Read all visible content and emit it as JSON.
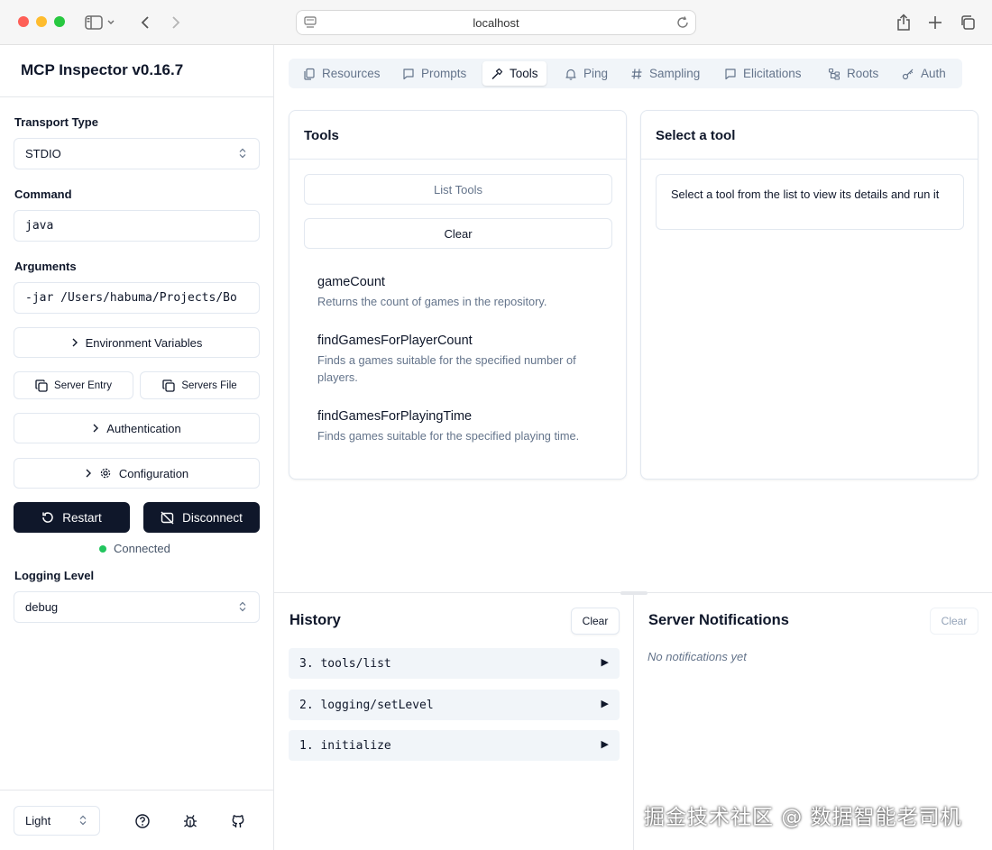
{
  "browser": {
    "url": "localhost"
  },
  "sidebar": {
    "title": "MCP Inspector v0.16.7",
    "transport_label": "Transport Type",
    "transport_value": "STDIO",
    "command_label": "Command",
    "command_value": "java",
    "arguments_label": "Arguments",
    "arguments_value": "-jar /Users/habuma/Projects/Bo",
    "env_vars_label": "Environment Variables",
    "server_entry_label": "Server Entry",
    "servers_file_label": "Servers File",
    "authentication_label": "Authentication",
    "configuration_label": "Configuration",
    "restart_label": "Restart",
    "disconnect_label": "Disconnect",
    "status_text": "Connected",
    "status_color": "#22c55e",
    "logging_label": "Logging Level",
    "logging_value": "debug",
    "theme_value": "Light"
  },
  "tabs": [
    {
      "label": "Resources",
      "icon": "file-icon"
    },
    {
      "label": "Prompts",
      "icon": "message-icon"
    },
    {
      "label": "Tools",
      "icon": "hammer-icon",
      "active": true
    },
    {
      "label": "Ping",
      "icon": "bell-icon"
    },
    {
      "label": "Sampling",
      "icon": "hash-icon"
    },
    {
      "label": "Elicitations",
      "icon": "message-icon"
    },
    {
      "label": "Roots",
      "icon": "folder-tree-icon"
    },
    {
      "label": "Auth",
      "icon": "key-icon"
    }
  ],
  "tools_panel": {
    "title": "Tools",
    "list_button": "List Tools",
    "clear_button": "Clear",
    "items": [
      {
        "name": "gameCount",
        "description": "Returns the count of games in the repository."
      },
      {
        "name": "findGamesForPlayerCount",
        "description": "Finds a games suitable for the specified number of players."
      },
      {
        "name": "findGamesForPlayingTime",
        "description": "Finds games suitable for the specified playing time."
      }
    ]
  },
  "detail_panel": {
    "title": "Select a tool",
    "hint": "Select a tool from the list to view its details and run it"
  },
  "history": {
    "title": "History",
    "clear_button": "Clear",
    "items": [
      {
        "label": "3. tools/list",
        "toggle": "▶"
      },
      {
        "label": "2. logging/setLevel",
        "toggle": "▶"
      },
      {
        "label": "1. initialize",
        "toggle": "▶"
      }
    ]
  },
  "notifications": {
    "title": "Server Notifications",
    "clear_button": "Clear",
    "empty_text": "No notifications yet"
  },
  "watermark": "掘金技术社区 @ 数据智能老司机"
}
